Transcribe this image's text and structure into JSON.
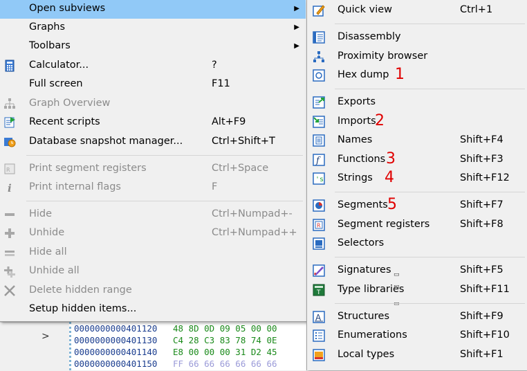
{
  "left_menu": {
    "items": [
      {
        "label": "Open subviews",
        "shortcut": "",
        "icon": "none",
        "submenu": true,
        "highlighted": true,
        "disabled": false
      },
      {
        "label": "Graphs",
        "shortcut": "",
        "icon": "none",
        "submenu": true,
        "disabled": false
      },
      {
        "label": "Toolbars",
        "shortcut": "",
        "icon": "none",
        "submenu": true,
        "disabled": false
      },
      {
        "label": "Calculator...",
        "shortcut": "?",
        "icon": "calculator-icon",
        "disabled": false
      },
      {
        "label": "Full screen",
        "shortcut": "F11",
        "icon": "none",
        "disabled": false
      },
      {
        "label": "Graph Overview",
        "shortcut": "",
        "icon": "graph-tree-icon",
        "disabled": true
      },
      {
        "label": "Recent scripts",
        "shortcut": "Alt+F9",
        "icon": "script-icon",
        "disabled": false
      },
      {
        "label": "Database snapshot manager...",
        "shortcut": "Ctrl+Shift+T",
        "icon": "snapshot-icon",
        "disabled": false
      },
      {
        "label": "Print segment registers",
        "shortcut": "Ctrl+Space",
        "icon": "segment-register-icon",
        "disabled": true
      },
      {
        "label": "Print internal flags",
        "shortcut": "F",
        "icon": "info-icon",
        "disabled": true
      },
      {
        "label": "Hide",
        "shortcut": "Ctrl+Numpad+-",
        "icon": "minus-icon",
        "disabled": true
      },
      {
        "label": "Unhide",
        "shortcut": "Ctrl+Numpad++",
        "icon": "plus-icon",
        "disabled": true
      },
      {
        "label": "Hide all",
        "shortcut": "",
        "icon": "minus-all-icon",
        "disabled": true
      },
      {
        "label": "Unhide all",
        "shortcut": "",
        "icon": "plus-all-icon",
        "disabled": true
      },
      {
        "label": "Delete hidden range",
        "shortcut": "",
        "icon": "delete-x-icon",
        "disabled": true
      },
      {
        "label": "Setup hidden items...",
        "shortcut": "",
        "icon": "none",
        "disabled": false
      }
    ]
  },
  "right_menu": {
    "items": [
      {
        "label": "Quick view",
        "shortcut": "Ctrl+1",
        "icon": "quick-view-icon"
      },
      {
        "label": "Disassembly",
        "shortcut": "",
        "icon": "disassembly-icon"
      },
      {
        "label": "Proximity browser",
        "shortcut": "",
        "icon": "proximity-icon"
      },
      {
        "label": "Hex dump",
        "shortcut": "",
        "icon": "hex-dump-icon"
      },
      {
        "label": "Exports",
        "shortcut": "",
        "icon": "exports-icon"
      },
      {
        "label": "Imports",
        "shortcut": "",
        "icon": "imports-icon"
      },
      {
        "label": "Names",
        "shortcut": "Shift+F4",
        "icon": "names-icon"
      },
      {
        "label": "Functions",
        "shortcut": "Shift+F3",
        "icon": "functions-icon"
      },
      {
        "label": "Strings",
        "shortcut": "Shift+F12",
        "icon": "strings-icon"
      },
      {
        "label": "Segments",
        "shortcut": "Shift+F7",
        "icon": "segments-icon"
      },
      {
        "label": "Segment registers",
        "shortcut": "Shift+F8",
        "icon": "segment-registers-icon"
      },
      {
        "label": "Selectors",
        "shortcut": "",
        "icon": "selectors-icon"
      },
      {
        "label": "Signatures",
        "shortcut": "Shift+F5",
        "icon": "signatures-icon"
      },
      {
        "label": "Type libraries",
        "shortcut": "Shift+F11",
        "icon": "type-libraries-icon"
      },
      {
        "label": "Structures",
        "shortcut": "Shift+F9",
        "icon": "structures-icon"
      },
      {
        "label": "Enumerations",
        "shortcut": "Shift+F10",
        "icon": "enumerations-icon"
      },
      {
        "label": "Local types",
        "shortcut": "Shift+F1",
        "icon": "local-types-icon"
      }
    ]
  },
  "annotations": [
    "1",
    "2",
    "3",
    "4",
    "5"
  ],
  "hex_view": {
    "collapse_arrow": ">",
    "lines": [
      {
        "addr": "0000000000401120",
        "bytes": "48 8D 0D 09 05 00 00"
      },
      {
        "addr": "0000000000401130",
        "bytes": "C4 28 C3 83 78 74 0E"
      },
      {
        "addr": "0000000000401140",
        "bytes": "E8 00 00 00 31 D2 45"
      },
      {
        "addr": "0000000000401150",
        "bytes": "FF 66 66 66 66 66 66"
      }
    ]
  },
  "colors": {
    "highlight": "#91c9f7",
    "disabled_text": "#8b8b8b",
    "annotation": "#e00000",
    "hex_address": "#1a3d8f",
    "hex_bytes": "#1a8a1a"
  }
}
